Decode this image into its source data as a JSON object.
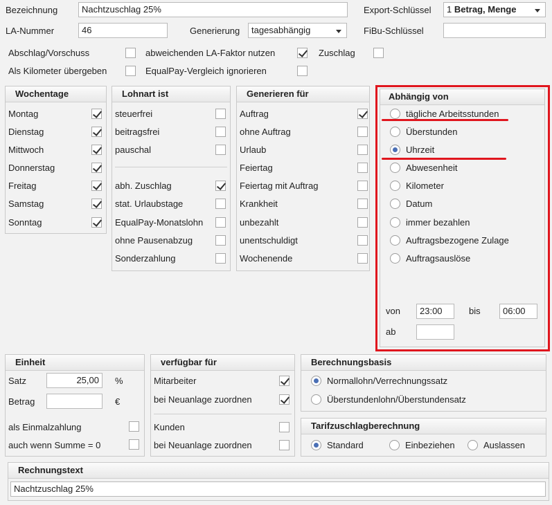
{
  "top": {
    "bezeichnung_label": "Bezeichnung",
    "bezeichnung_value": "Nachtzuschlag 25%",
    "export_label": "Export-Schlüssel",
    "export_value_num": "1",
    "export_value_text": "Betrag, Menge",
    "la_label": "LA-Nummer",
    "la_value": "46",
    "generierung_label": "Generierung",
    "generierung_value": "tagesabhängig",
    "fibu_label": "FiBu-Schlüssel",
    "fibu_value": "",
    "abschlag_label": "Abschlag/Vorschuss",
    "abschlag_checked": false,
    "la_faktor_label": "abweichenden LA-Faktor nutzen",
    "la_faktor_checked": true,
    "zuschlag_label": "Zuschlag",
    "zuschlag_checked": false,
    "km_label": "Als Kilometer übergeben",
    "km_checked": false,
    "equalpay_label": "EqualPay-Vergleich ignorieren",
    "equalpay_checked": false
  },
  "wochentage": {
    "title": "Wochentage",
    "items": [
      {
        "label": "Montag",
        "checked": true
      },
      {
        "label": "Dienstag",
        "checked": true
      },
      {
        "label": "Mittwoch",
        "checked": true
      },
      {
        "label": "Donnerstag",
        "checked": true
      },
      {
        "label": "Freitag",
        "checked": true
      },
      {
        "label": "Samstag",
        "checked": true
      },
      {
        "label": "Sonntag",
        "checked": true
      }
    ]
  },
  "lohnart": {
    "title": "Lohnart ist",
    "items": [
      {
        "label": "steuerfrei",
        "checked": false
      },
      {
        "label": "beitragsfrei",
        "checked": false
      },
      {
        "label": "pauschal",
        "checked": false
      },
      {
        "label": "abh. Zuschlag",
        "checked": true
      },
      {
        "label": "stat. Urlaubstage",
        "checked": false
      },
      {
        "label": "EqualPay-Monatslohn",
        "checked": false
      },
      {
        "label": "ohne Pausenabzug",
        "checked": false
      },
      {
        "label": "Sonderzahlung",
        "checked": false
      }
    ]
  },
  "generieren": {
    "title": "Generieren für",
    "items": [
      {
        "label": "Auftrag",
        "checked": true
      },
      {
        "label": "ohne Auftrag",
        "checked": false
      },
      {
        "label": "Urlaub",
        "checked": false
      },
      {
        "label": "Feiertag",
        "checked": false
      },
      {
        "label": "Feiertag mit Auftrag",
        "checked": false
      },
      {
        "label": "Krankheit",
        "checked": false
      },
      {
        "label": "unbezahlt",
        "checked": false
      },
      {
        "label": "unentschuldigt",
        "checked": false
      },
      {
        "label": "Wochenende",
        "checked": false
      }
    ]
  },
  "abhaengig": {
    "title": "Abhängig von",
    "selected": 2,
    "items": [
      {
        "label": "tägliche Arbeitsstunden"
      },
      {
        "label": "Überstunden"
      },
      {
        "label": "Uhrzeit"
      },
      {
        "label": "Abwesenheit"
      },
      {
        "label": "Kilometer"
      },
      {
        "label": "Datum"
      },
      {
        "label": "immer bezahlen"
      },
      {
        "label": "Auftragsbezogene Zulage"
      },
      {
        "label": "Auftragsauslöse"
      }
    ],
    "von_label": "von",
    "von_value": "23:00",
    "bis_label": "bis",
    "bis_value": "06:00",
    "ab_label": "ab",
    "ab_value": ""
  },
  "einheit": {
    "title": "Einheit",
    "satz_label": "Satz",
    "satz_value": "25,00",
    "satz_unit": "%",
    "betrag_label": "Betrag",
    "betrag_value": "",
    "betrag_unit": "€",
    "einmal_label": "als Einmalzahlung",
    "einmal_checked": false,
    "summe_label": "auch wenn Summe = 0",
    "summe_checked": false
  },
  "verfuegbar": {
    "title": "verfügbar für",
    "items": [
      {
        "label": "Mitarbeiter",
        "checked": true
      },
      {
        "label": "bei Neuanlage zuordnen",
        "checked": true
      },
      {
        "label": "Kunden",
        "checked": false
      },
      {
        "label": "bei Neuanlage zuordnen",
        "checked": false
      }
    ]
  },
  "berechnung": {
    "title": "Berechnungsbasis",
    "selected": 0,
    "items": [
      {
        "label": "Normallohn/Verrechnungssatz"
      },
      {
        "label": "Überstundenlohn/Überstundensatz"
      }
    ]
  },
  "tarif": {
    "title": "Tarifzuschlagberechnung",
    "selected": 0,
    "items": [
      {
        "label": "Standard"
      },
      {
        "label": "Einbeziehen"
      },
      {
        "label": "Auslassen"
      }
    ]
  },
  "rechnung": {
    "title": "Rechnungstext",
    "value": "Nachtzuschlag 25%"
  },
  "colors": {
    "highlight_red": "#e0161e",
    "radio_selected": "#4a6fb5"
  }
}
